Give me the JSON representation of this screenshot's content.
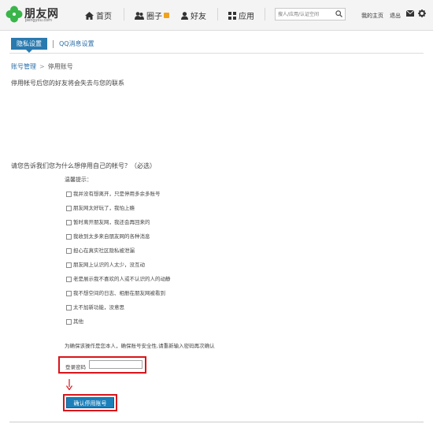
{
  "header": {
    "logo_text": "朋友网",
    "logo_sub": "pengyou.com",
    "nav": {
      "home": "首页",
      "circle": "圈子",
      "friends": "好友",
      "apps": "应用"
    },
    "search_placeholder": "搜人/应用/认证空间",
    "my_home": "我的主页",
    "logout": "退出"
  },
  "tabs": {
    "privacy": "隐私设置",
    "qq_msg": "QQ消息设置"
  },
  "breadcrumb": {
    "parent": "账号管理",
    "separator": ">",
    "current": "停用账号"
  },
  "warning": "停用帐号后您的好友将会失去与您的联系",
  "question": "请您告诉我们您为什么想停用自己的帐号？（必选）",
  "hint": "温馨提示：",
  "options": [
    "我并没有想离开，只是停用多余多账号",
    "朋友网太好玩了，我怕上瘾",
    "暂时离开朋友网，我还会再回来的",
    "我收到太多来自朋友网的各种消息",
    "担心在真实社区隐私被泄漏",
    "朋友网上认识的人太少，没互动",
    "老是展示我不喜欢的人或不认识的人的动静",
    "我不想空间的日志、相册在朋友网被看到",
    "太不加新功能，没意思",
    "其他"
  ],
  "confirm_text": "为确保该操作是您本人，确保账号安全性,请重新输入密码再次确认",
  "password_label": "登录密码",
  "submit_label": "确认停用账号",
  "colors": {
    "accent": "#2a7aaf",
    "highlight": "#d9151b",
    "logo_green": "#39b54a"
  }
}
